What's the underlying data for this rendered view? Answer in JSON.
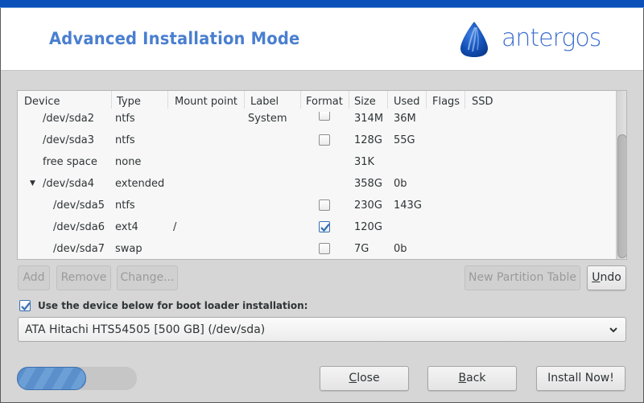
{
  "header": {
    "title": "Advanced Installation Mode",
    "logo_text": "antergos",
    "logo_icon": "antergos-drop-logo"
  },
  "colors": {
    "topbar": "#0b4fb8",
    "title": "#4a7fd0",
    "logo": "#3d6fd0",
    "checkbox_accent": "#3b6fb0",
    "progress": "#5a8fcb"
  },
  "partition_table": {
    "columns": [
      "Device",
      "Type",
      "Mount point",
      "Label",
      "Format",
      "Size",
      "Used",
      "Flags",
      "SSD"
    ],
    "rows": [
      {
        "device": "/dev/sda2",
        "type": "ntfs",
        "mount": "",
        "label": "System",
        "format": false,
        "show_format": true,
        "size": "314M",
        "used": "36M",
        "flags": "",
        "ssd": "",
        "level": 1
      },
      {
        "device": "/dev/sda3",
        "type": "ntfs",
        "mount": "",
        "label": "",
        "format": false,
        "show_format": true,
        "size": "128G",
        "used": "55G",
        "flags": "",
        "ssd": "",
        "level": 1
      },
      {
        "device": "free space",
        "type": "none",
        "mount": "",
        "label": "",
        "format": false,
        "show_format": false,
        "size": "31K",
        "used": "",
        "flags": "",
        "ssd": "",
        "level": 1
      },
      {
        "device": "/dev/sda4",
        "type": "extended",
        "mount": "",
        "label": "",
        "format": false,
        "show_format": false,
        "size": "358G",
        "used": "0b",
        "flags": "",
        "ssd": "",
        "level": 1,
        "expanded": true
      },
      {
        "device": "/dev/sda5",
        "type": "ntfs",
        "mount": "",
        "label": "",
        "format": false,
        "show_format": true,
        "size": "230G",
        "used": "143G",
        "flags": "",
        "ssd": "",
        "level": 2
      },
      {
        "device": "/dev/sda6",
        "type": "ext4",
        "mount": "/",
        "label": "",
        "format": true,
        "show_format": true,
        "size": "120G",
        "used": "",
        "flags": "",
        "ssd": "",
        "level": 2
      },
      {
        "device": "/dev/sda7",
        "type": "swap",
        "mount": "",
        "label": "",
        "format": false,
        "show_format": true,
        "size": "7G",
        "used": "0b",
        "flags": "",
        "ssd": "",
        "level": 2
      }
    ]
  },
  "actions": {
    "add": "Add",
    "remove": "Remove",
    "change": "Change...",
    "new_partition_table": "New Partition Table",
    "undo_mnemonic": "U",
    "undo_rest": "ndo"
  },
  "bootloader": {
    "checked": true,
    "label": "Use the device below for boot loader installation:",
    "selected_device": "ATA Hitachi HTS54505 [500 GB] (/dev/sda)"
  },
  "footer": {
    "progress_fraction": 0.58,
    "close_mnemonic": "C",
    "close_rest": "lose",
    "back_mnemonic": "B",
    "back_rest": "ack",
    "install": "Install Now!"
  }
}
